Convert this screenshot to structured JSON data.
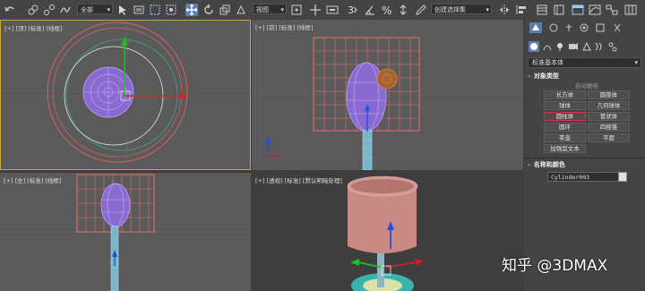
{
  "toolbar": {
    "selection_filter": "全部",
    "view_dropdown": "视图",
    "named_selection_set": "创建选择集",
    "icons": [
      "undo-icon",
      "redo-icon",
      "link-icon",
      "unlink-icon",
      "bind-space-warp-icon",
      "select-object-icon",
      "select-by-name-icon",
      "rect-selection-region-icon",
      "window-crossing-icon",
      "select-move-icon",
      "select-rotate-icon",
      "select-scale-icon",
      "reference-coord-icon",
      "pivot-center-icon",
      "select-manipulate-icon",
      "keyboard-shortcut-icon",
      "snap-3d-icon",
      "angle-snap-icon",
      "percent-snap-icon",
      "spinner-snap-icon",
      "edit-named-selection-icon",
      "mirror-icon",
      "align-icon",
      "scene-explorer-icon",
      "layer-explorer-icon",
      "ribbon-icon",
      "curve-editor-icon",
      "schematic-view-icon",
      "material-editor-icon",
      "render-setup-icon"
    ]
  },
  "viewports": {
    "top_left": {
      "label": "[+] [顶] [标准] [线框]"
    },
    "top_right": {
      "label": "[+] [前] [标准] [线框]"
    },
    "bottom_left": {
      "label": "[+] [左] [标准] [线框]"
    },
    "bottom_right": {
      "label": "[+] [透视] [标准] [默认明暗处理]"
    }
  },
  "command_panel": {
    "tabs": [
      "create-tab-icon",
      "modify-tab-icon",
      "hierarchy-tab-icon",
      "motion-tab-icon",
      "display-tab-icon",
      "utilities-tab-icon"
    ],
    "subtabs": [
      "geometry-icon",
      "shapes-icon",
      "lights-icon",
      "cameras-icon",
      "helpers-icon",
      "space-warps-icon",
      "systems-icon"
    ],
    "category": "标准基本体",
    "object_type_header": "对象类型",
    "autogrid": "自动栅格",
    "buttons": [
      "长方体",
      "圆锥体",
      "球体",
      "几何球体",
      "圆柱体",
      "管状体",
      "圆环",
      "四棱锥",
      "茶壶",
      "平面",
      "加强型文本"
    ],
    "selected_button": "圆柱体",
    "name_color_header": "名称和颜色",
    "object_name": "Cylinder003",
    "object_color": "#d6ead2"
  },
  "watermark": "知乎 @3DMAX"
}
